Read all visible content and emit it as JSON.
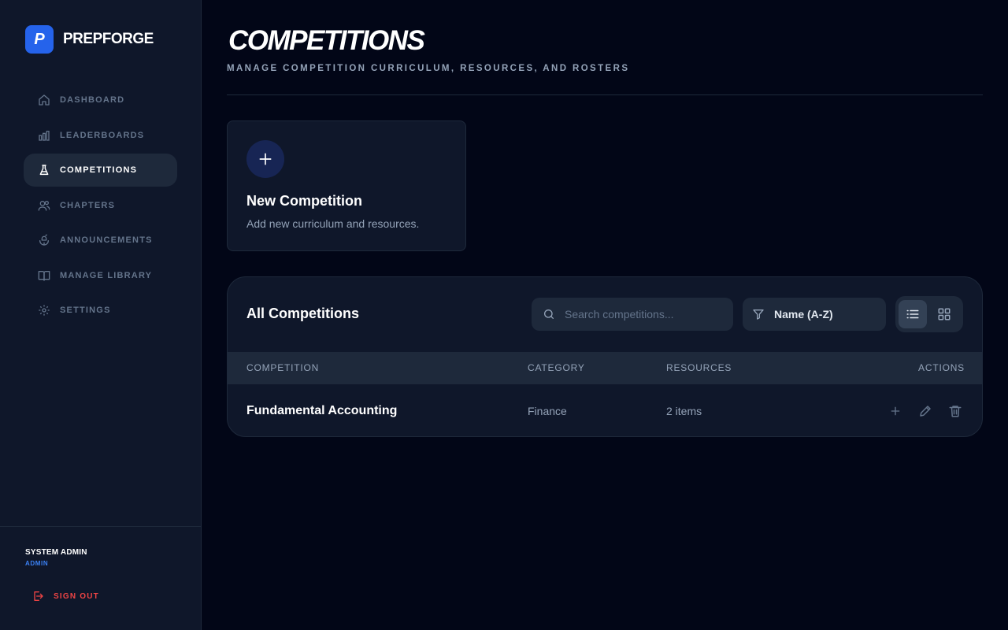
{
  "brand": {
    "logo_letter": "P",
    "name": "PREPFORGE",
    "accent": "#2563eb"
  },
  "nav": [
    {
      "label": "DASHBOARD",
      "icon": "home-icon"
    },
    {
      "label": "LEADERBOARDS",
      "icon": "bar-chart-icon"
    },
    {
      "label": "COMPETITIONS",
      "icon": "flask-icon",
      "active": true
    },
    {
      "label": "CHAPTERS",
      "icon": "users-icon"
    },
    {
      "label": "ANNOUNCEMENTS",
      "icon": "megaphone-icon"
    },
    {
      "label": "MANAGE LIBRARY",
      "icon": "book-icon"
    },
    {
      "label": "SETTINGS",
      "icon": "gear-icon"
    }
  ],
  "user": {
    "name": "SYSTEM ADMIN",
    "role": "ADMIN"
  },
  "signout_label": "SIGN OUT",
  "header": {
    "title": "COMPETITIONS",
    "subtitle": "MANAGE COMPETITION CURRICULUM, RESOURCES, AND ROSTERS"
  },
  "new_card": {
    "title": "New Competition",
    "description": "Add new curriculum and resources."
  },
  "panel": {
    "title": "All Competitions",
    "search_placeholder": "Search competitions...",
    "sort_value": "Name (A-Z)",
    "view_mode": "list"
  },
  "table": {
    "columns": [
      "COMPETITION",
      "CATEGORY",
      "RESOURCES",
      "ACTIONS"
    ],
    "rows": [
      {
        "competition": "Fundamental Accounting",
        "category": "Finance",
        "resources": "2 items"
      }
    ]
  },
  "colors": {
    "background": "#020617",
    "sidebar": "#0f172a",
    "danger": "#ef4444",
    "role": "#3b82f6"
  }
}
